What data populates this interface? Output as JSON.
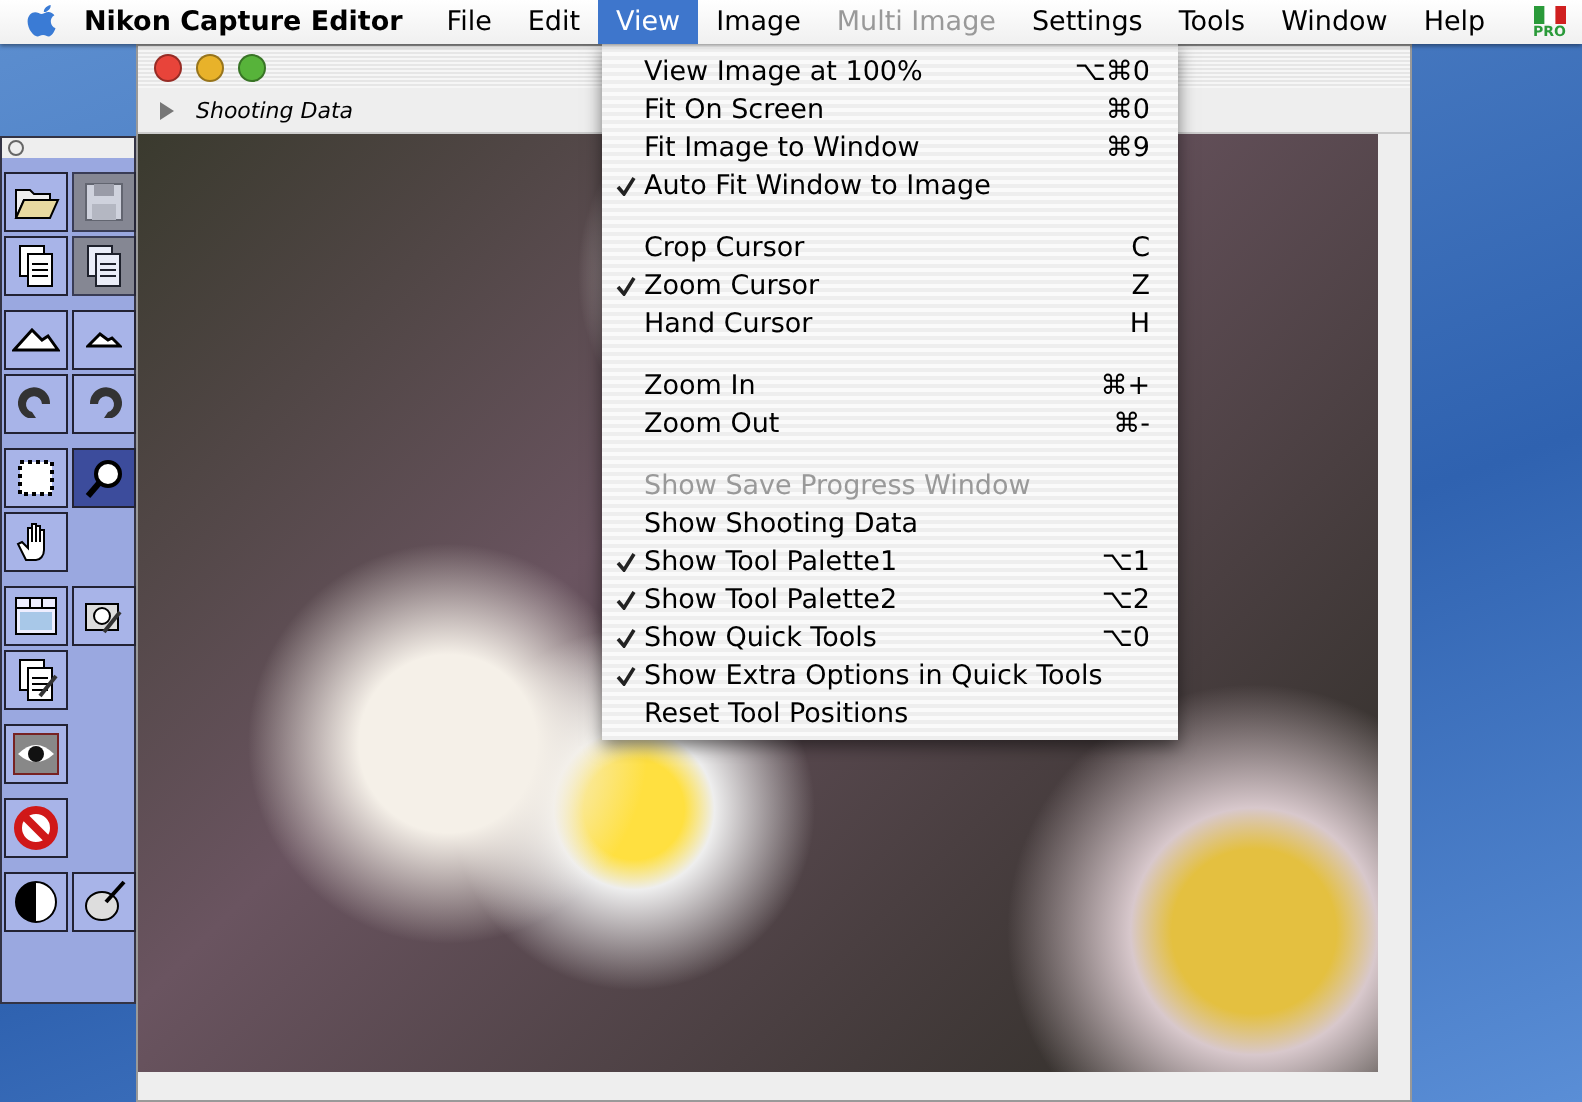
{
  "menu_bar": {
    "app_name": "Nikon Capture Editor",
    "items": [
      {
        "label": "File",
        "selected": false,
        "disabled": false
      },
      {
        "label": "Edit",
        "selected": false,
        "disabled": false
      },
      {
        "label": "View",
        "selected": true,
        "disabled": false
      },
      {
        "label": "Image",
        "selected": false,
        "disabled": false
      },
      {
        "label": "Multi Image",
        "selected": false,
        "disabled": true
      },
      {
        "label": "Settings",
        "selected": false,
        "disabled": false
      },
      {
        "label": "Tools",
        "selected": false,
        "disabled": false
      },
      {
        "label": "Window",
        "selected": false,
        "disabled": false
      },
      {
        "label": "Help",
        "selected": false,
        "disabled": false
      }
    ],
    "badge": "PRO"
  },
  "view_menu": [
    {
      "kind": "item",
      "label": "View Image at 100%",
      "shortcut": "⌥⌘0",
      "checked": false,
      "disabled": false
    },
    {
      "kind": "item",
      "label": "Fit On Screen",
      "shortcut": "⌘0",
      "checked": false,
      "disabled": false
    },
    {
      "kind": "item",
      "label": "Fit Image to Window",
      "shortcut": "⌘9",
      "checked": false,
      "disabled": false
    },
    {
      "kind": "item",
      "label": "Auto Fit Window to Image",
      "checked": true,
      "disabled": false
    },
    {
      "kind": "separator"
    },
    {
      "kind": "item",
      "label": "Crop Cursor",
      "shortcut": "C",
      "checked": false,
      "disabled": false
    },
    {
      "kind": "item",
      "label": "Zoom Cursor",
      "shortcut": "Z",
      "checked": true,
      "disabled": false
    },
    {
      "kind": "item",
      "label": "Hand Cursor",
      "shortcut": "H",
      "checked": false,
      "disabled": false
    },
    {
      "kind": "separator"
    },
    {
      "kind": "item",
      "label": "Zoom In",
      "shortcut": "⌘+",
      "checked": false,
      "disabled": false
    },
    {
      "kind": "item",
      "label": "Zoom Out",
      "shortcut": "⌘-",
      "checked": false,
      "disabled": false
    },
    {
      "kind": "separator"
    },
    {
      "kind": "item",
      "label": "Show Save Progress Window",
      "checked": false,
      "disabled": true
    },
    {
      "kind": "item",
      "label": "Show Shooting Data",
      "checked": false,
      "disabled": false
    },
    {
      "kind": "item",
      "label": "Show Tool Palette1",
      "shortcut": "⌥1",
      "checked": true,
      "disabled": false
    },
    {
      "kind": "item",
      "label": "Show Tool Palette2",
      "shortcut": "⌥2",
      "checked": true,
      "disabled": false
    },
    {
      "kind": "item",
      "label": "Show Quick Tools",
      "shortcut": "⌥0",
      "checked": true,
      "disabled": false
    },
    {
      "kind": "item",
      "label": "Show Extra Options in Quick Tools",
      "checked": true,
      "disabled": false
    },
    {
      "kind": "item",
      "label": "Reset Tool Positions",
      "checked": false,
      "disabled": false
    }
  ],
  "image_window": {
    "shooting_data": {
      "label": "Shooting Data",
      "expanded": false
    }
  },
  "tool_palette": {
    "groups": [
      {
        "tools": [
          {
            "kind": "open",
            "selected": false,
            "disabled": false
          },
          {
            "kind": "save",
            "selected": false,
            "disabled": true
          },
          {
            "kind": "document",
            "selected": false,
            "disabled": false
          },
          {
            "kind": "documents",
            "selected": false,
            "disabled": true
          }
        ]
      },
      {
        "tools": [
          {
            "kind": "mountain-large",
            "selected": false,
            "disabled": false
          },
          {
            "kind": "mountain-small",
            "selected": false,
            "disabled": false
          },
          {
            "kind": "rotate-left",
            "selected": false,
            "disabled": false
          },
          {
            "kind": "rotate-right",
            "selected": false,
            "disabled": false
          }
        ]
      },
      {
        "tools": [
          {
            "kind": "crop",
            "selected": false,
            "disabled": false
          },
          {
            "kind": "zoom",
            "selected": true,
            "disabled": false
          },
          {
            "kind": "hand",
            "selected": false,
            "disabled": false
          }
        ]
      },
      {
        "tools": [
          {
            "kind": "layout",
            "selected": false,
            "disabled": false
          },
          {
            "kind": "camera",
            "selected": false,
            "disabled": false
          },
          {
            "kind": "edit",
            "selected": false,
            "disabled": false
          }
        ]
      },
      {
        "tools": [
          {
            "kind": "eye",
            "selected": false,
            "disabled": false
          }
        ]
      },
      {
        "tools": [
          {
            "kind": "stop",
            "selected": false,
            "disabled": false
          }
        ]
      },
      {
        "tools": [
          {
            "kind": "contrast",
            "selected": false,
            "disabled": false
          },
          {
            "kind": "mouse",
            "selected": false,
            "disabled": false
          }
        ]
      }
    ]
  }
}
